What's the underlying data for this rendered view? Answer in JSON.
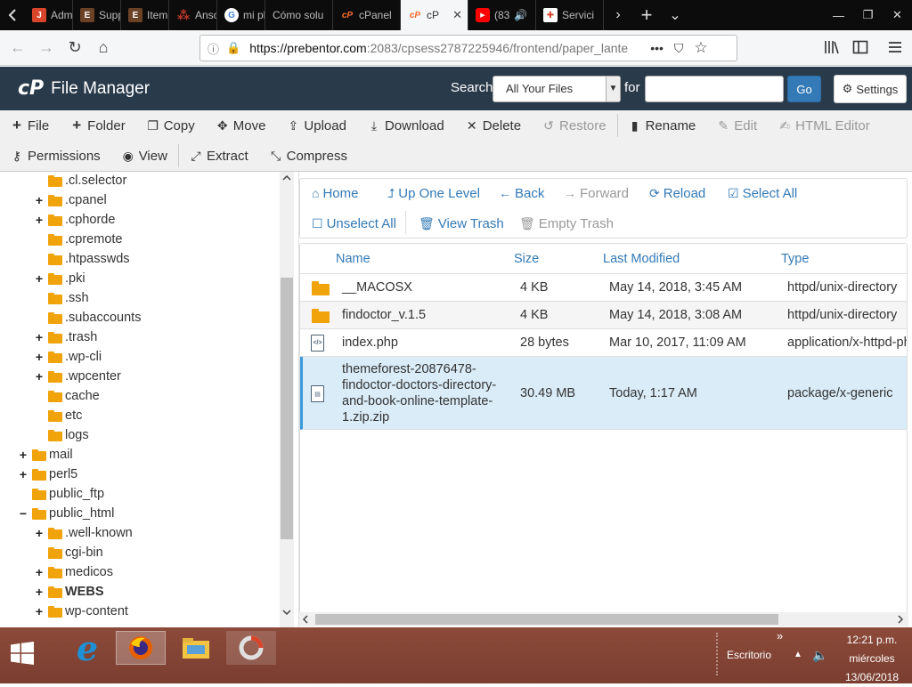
{
  "browser": {
    "tabs": [
      {
        "label": "Admin",
        "icon": "joomla-icon",
        "color": "#d9452b"
      },
      {
        "label": "Suppo",
        "icon": "themeforest-icon",
        "color": "#6b4226"
      },
      {
        "label": "Item S",
        "icon": "themeforest-icon",
        "color": "#6b4226"
      },
      {
        "label": "Anson",
        "icon": "slack-icon",
        "color": "#c0392b"
      },
      {
        "label": "mi pla",
        "icon": "google-icon",
        "color": "#4285f4"
      },
      {
        "label": "Cómo solu",
        "icon": "blank-icon",
        "color": ""
      },
      {
        "label": "cPanel",
        "icon": "cpanel-icon",
        "color": "#ff6c2c"
      },
      {
        "label": "cP",
        "icon": "cpanel-icon",
        "color": "#ff6c2c",
        "active": true
      },
      {
        "label": "(83",
        "icon": "youtube-icon",
        "color": "#ff0000"
      },
      {
        "label": "Servici",
        "icon": "service-icon",
        "color": "#d9452b"
      }
    ],
    "url_host": "https://prebentor.com",
    "url_path": ":2083/cpsess2787225946/frontend/paper_lante",
    "url_overflow": "•••"
  },
  "cpanel": {
    "logo": "cP",
    "title": "File Manager",
    "search_label": "Search",
    "search_scope": "All Your Files",
    "for_label": "for",
    "go_label": "Go",
    "settings_label": "Settings"
  },
  "toolbar": {
    "row1": [
      {
        "label": "File",
        "icon": "plus-icon",
        "enabled": true
      },
      {
        "label": "Folder",
        "icon": "plus-icon",
        "enabled": true
      },
      {
        "label": "Copy",
        "icon": "copy-icon",
        "enabled": true
      },
      {
        "label": "Move",
        "icon": "move-icon",
        "enabled": true
      },
      {
        "label": "Upload",
        "icon": "upload-icon",
        "enabled": true
      },
      {
        "label": "Download",
        "icon": "download-icon",
        "enabled": true
      },
      {
        "label": "Delete",
        "icon": "close-icon",
        "enabled": true
      },
      {
        "label": "Restore",
        "icon": "undo-icon",
        "enabled": false
      },
      {
        "label": "Rename",
        "icon": "file-icon",
        "enabled": true
      },
      {
        "label": "Edit",
        "icon": "pencil-icon",
        "enabled": false
      },
      {
        "label": "HTML Editor",
        "icon": "edit-icon",
        "enabled": false
      }
    ],
    "row2": [
      {
        "label": "Permissions",
        "icon": "key-icon",
        "enabled": true
      },
      {
        "label": "View",
        "icon": "eye-icon",
        "enabled": true
      },
      {
        "label": "Extract",
        "icon": "expand-icon",
        "enabled": true
      },
      {
        "label": "Compress",
        "icon": "compress-icon",
        "enabled": true
      }
    ]
  },
  "tree": [
    {
      "label": ".cl.selector",
      "expand": ""
    },
    {
      "label": ".cpanel",
      "expand": "+"
    },
    {
      "label": ".cphorde",
      "expand": "+"
    },
    {
      "label": ".cpremote",
      "expand": ""
    },
    {
      "label": ".htpasswds",
      "expand": ""
    },
    {
      "label": ".pki",
      "expand": "+"
    },
    {
      "label": ".ssh",
      "expand": ""
    },
    {
      "label": ".subaccounts",
      "expand": ""
    },
    {
      "label": ".trash",
      "expand": "+"
    },
    {
      "label": ".wp-cli",
      "expand": "+"
    },
    {
      "label": ".wpcenter",
      "expand": "+"
    },
    {
      "label": "cache",
      "expand": ""
    },
    {
      "label": "etc",
      "expand": ""
    },
    {
      "label": "logs",
      "expand": ""
    },
    {
      "label": "mail",
      "expand": "+"
    },
    {
      "label": "perl5",
      "expand": "+"
    },
    {
      "label": "public_ftp",
      "expand": ""
    },
    {
      "label": "public_html",
      "expand": "−"
    },
    {
      "label": ".well-known",
      "expand": "+"
    },
    {
      "label": "cgi-bin",
      "expand": ""
    },
    {
      "label": "medicos",
      "expand": "+"
    },
    {
      "label": "WEBS",
      "expand": "+",
      "bold": true
    },
    {
      "label": "wp-content",
      "expand": "+"
    }
  ],
  "file_nav": {
    "home": "Home",
    "up": "Up One Level",
    "back": "Back",
    "forward": "Forward",
    "reload": "Reload",
    "select_all": "Select All",
    "unselect_all": "Unselect All",
    "view_trash": "View Trash",
    "empty_trash": "Empty Trash"
  },
  "files": {
    "headers": [
      "Name",
      "Size",
      "Last Modified",
      "Type"
    ],
    "rows": [
      {
        "name": "__MACOSX",
        "size": "4 KB",
        "modified": "May 14, 2018, 3:45 AM",
        "type": "httpd/unix-directory",
        "icon": "folder-icon"
      },
      {
        "name": "findoctor_v.1.5",
        "size": "4 KB",
        "modified": "May 14, 2018, 3:08 AM",
        "type": "httpd/unix-directory",
        "icon": "folder-icon"
      },
      {
        "name": "index.php",
        "size": "28 bytes",
        "modified": "Mar 10, 2017, 11:09 AM",
        "type": "application/x-httpd-ph",
        "icon": "code-file-icon"
      },
      {
        "name_lines": [
          "themeforest-20876478-",
          "findoctor-doctors-directory-",
          "and-book-online-template-",
          "1.zip.zip"
        ],
        "size": "30.49 MB",
        "modified": "Today, 1:17 AM",
        "type": "package/x-generic",
        "icon": "archive-file-icon",
        "selected": true
      }
    ]
  },
  "taskbar": {
    "tray_label": "Escritorio",
    "time": "12:21 p.m.",
    "day": "miércoles",
    "date": "13/06/2018",
    "chevron": "»"
  }
}
